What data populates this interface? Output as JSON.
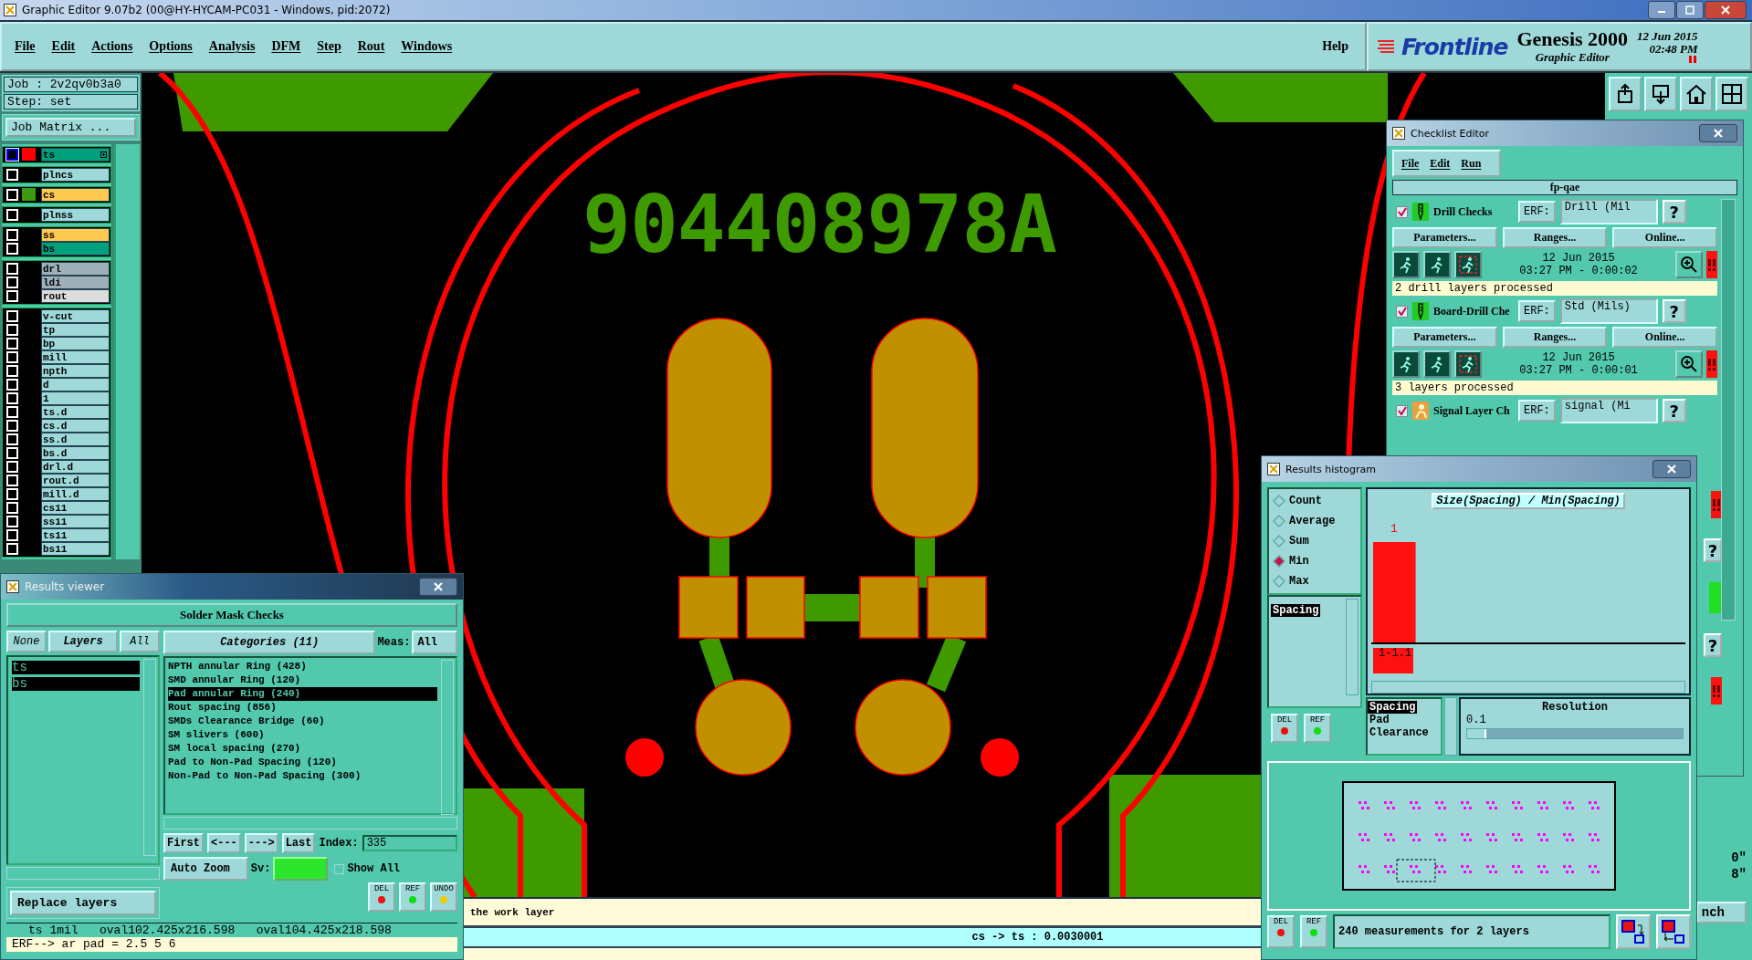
{
  "window": {
    "title": "Graphic Editor 9.07b2 (00@HY-HYCAM-PC031 - Windows, pid:2072)"
  },
  "menu": [
    {
      "label": "File"
    },
    {
      "label": "Edit"
    },
    {
      "label": "Actions"
    },
    {
      "label": "Options"
    },
    {
      "label": "Analysis"
    },
    {
      "label": "DFM"
    },
    {
      "label": "Step"
    },
    {
      "label": "Rout"
    },
    {
      "label": "Windows"
    }
  ],
  "help": "Help",
  "brand": {
    "logo": "Frontline",
    "product": "Genesis 2000",
    "subtitle": "Graphic Editor",
    "date": "12 Jun 2015",
    "time": "02:48 PM"
  },
  "job": {
    "job": "Job : 2v2qv0b3a0",
    "step": "Step: set",
    "matrix_button": "Job Matrix ..."
  },
  "layer_groups": [
    {
      "layers": [
        {
          "name": "ts",
          "color": "#00a07c",
          "swatch": {
            "color": "#ff0000"
          },
          "work_layer": true
        }
      ]
    },
    {
      "layers": [
        {
          "name": "plncs",
          "color": "#9ed8d8",
          "work_layer": false
        }
      ]
    },
    {
      "layers": [
        {
          "name": "cs",
          "color": "#ffc850",
          "swatch": {
            "color": "#3c9a10"
          },
          "work_layer": false
        }
      ]
    },
    {
      "layers": [
        {
          "name": "plnss",
          "color": "#9ed8d8",
          "work_layer": false
        }
      ]
    },
    {
      "layers": [
        {
          "name": "ss",
          "color": "#ffc850",
          "work_layer": false
        },
        {
          "name": "bs",
          "color": "#00a07c",
          "work_layer": false
        }
      ]
    },
    {
      "layers": [
        {
          "name": "drl",
          "color": "#9fb0b8",
          "work_layer": false
        },
        {
          "name": "ldi",
          "color": "#9fb0b8",
          "work_layer": false
        },
        {
          "name": "rout",
          "color": "#dcdcdc",
          "work_layer": false
        }
      ]
    },
    {
      "layers": [
        {
          "name": "v-cut",
          "color": "#9ed8d8",
          "work_layer": false
        },
        {
          "name": "tp",
          "color": "#9ed8d8",
          "work_layer": false
        },
        {
          "name": "bp",
          "color": "#9ed8d8",
          "work_layer": false
        },
        {
          "name": "mill",
          "color": "#9ed8d8",
          "work_layer": false
        },
        {
          "name": "npth",
          "color": "#9ed8d8",
          "work_layer": false
        },
        {
          "name": "d",
          "color": "#9ed8d8",
          "work_layer": false
        },
        {
          "name": "1",
          "color": "#9ed8d8",
          "work_layer": false
        },
        {
          "name": "ts.d",
          "color": "#9ed8d8",
          "work_layer": false
        },
        {
          "name": "cs.d",
          "color": "#9ed8d8",
          "work_layer": false
        },
        {
          "name": "ss.d",
          "color": "#9ed8d8",
          "work_layer": false
        },
        {
          "name": "bs.d",
          "color": "#9ed8d8",
          "work_layer": false
        },
        {
          "name": "drl.d",
          "color": "#9ed8d8",
          "work_layer": false
        },
        {
          "name": "rout.d",
          "color": "#9ed8d8",
          "work_layer": false
        },
        {
          "name": "mill.d",
          "color": "#9ed8d8",
          "work_layer": false
        },
        {
          "name": "cs11",
          "color": "#9ed8d8",
          "work_layer": false
        },
        {
          "name": "ss11",
          "color": "#9ed8d8",
          "work_layer": false
        },
        {
          "name": "ts11",
          "color": "#9ed8d8",
          "work_layer": false
        },
        {
          "name": "bs11",
          "color": "#9ed8d8",
          "work_layer": false
        }
      ]
    }
  ],
  "board_text": "904408978A",
  "prompt": "the work layer",
  "status": "cs -> ts : 0.0030001",
  "right_panel": {
    "lines": [
      "0\"",
      "8\""
    ],
    "unit": "nch"
  },
  "results_viewer": {
    "title": "Results viewer",
    "heading": "Solder Mask Checks",
    "layer_buttons": [
      "None",
      "Layers",
      "All"
    ],
    "layers": [
      {
        "name": "ts",
        "selected": true
      },
      {
        "name": "bs",
        "selected": true
      }
    ],
    "replace": "Replace layers",
    "categories_header": "Categories (11)",
    "meas_label": "Meas:",
    "meas_value": "All",
    "categories": [
      {
        "label": "NPTH annular Ring (428)",
        "selected": false
      },
      {
        "label": "SMD annular Ring (120)",
        "selected": false
      },
      {
        "label": "Pad annular Ring (240)",
        "selected": true
      },
      {
        "label": "Rout spacing (856)",
        "selected": false
      },
      {
        "label": "SMDs Clearance Bridge (60)",
        "selected": false
      },
      {
        "label": "SM slivers (600)",
        "selected": false
      },
      {
        "label": "SM local spacing (270)",
        "selected": false
      },
      {
        "label": "Pad to Non-Pad Spacing (120)",
        "selected": false
      },
      {
        "label": "Non-Pad to Non-Pad Spacing (300)",
        "selected": false
      }
    ],
    "nav": [
      "First",
      "<---",
      "--->",
      "Last"
    ],
    "index_label": "Index:",
    "index_value": "335",
    "zoom": "Auto Zoom",
    "sv_label": "Sv:",
    "show_all": {
      "label": "Show All",
      "checked": false
    },
    "actions": [
      "DEL",
      "REF",
      "UNDO"
    ],
    "info": "ts 1mil   oval102.425x216.598   oval104.425x218.598",
    "erf": "ERF--> ar pad = 2.5 5 6"
  },
  "checklist": {
    "title": "Checklist Editor",
    "menu": [
      "File",
      "Edit",
      "Run"
    ],
    "name": "fp-qae",
    "help": "?",
    "items": [
      {
        "name": "Drill Checks",
        "kind": "drill",
        "checked": true,
        "erf_label": "ERF:",
        "erf": "Drill (Mil",
        "buttons": [
          "Parameters...",
          "Ranges...",
          "Online..."
        ],
        "date": "12 Jun 2015",
        "time": "03:27 PM - 0:00:02",
        "message": "2 drill layers processed"
      },
      {
        "name": "Board-Drill Che",
        "kind": "drill",
        "checked": true,
        "erf_label": "ERF:",
        "erf": "Std (Mils)",
        "buttons": [
          "Parameters...",
          "Ranges...",
          "Online..."
        ],
        "date": "12 Jun 2015",
        "time": "03:27 PM - 0:00:01",
        "message": "3 layers processed"
      },
      {
        "name": "Signal Layer Ch",
        "kind": "signal",
        "checked": true,
        "erf_label": "ERF:",
        "erf": "signal (Mi"
      }
    ],
    "edge": [
      {
        "kind": "flag"
      },
      {
        "kind": "help",
        "label": "?"
      },
      {
        "kind": "ok"
      },
      {
        "kind": "help",
        "label": "?"
      },
      {
        "kind": "flag"
      }
    ]
  },
  "histogram": {
    "title": "Results histogram",
    "stats": [
      {
        "label": "Count",
        "selected": false
      },
      {
        "label": "Average",
        "selected": false
      },
      {
        "label": "Sum",
        "selected": false
      },
      {
        "label": "Min",
        "selected": true
      },
      {
        "label": "Max",
        "selected": false
      }
    ],
    "measures": [
      {
        "label": "Spacing",
        "selected": true
      }
    ],
    "actions": [
      "DEL",
      "REF"
    ],
    "chart": {
      "title": "Size(Spacing) / Min(Spacing)",
      "bins": [
        {
          "count": "1",
          "range": "1-1.1"
        }
      ]
    },
    "fields": [
      {
        "label": "Spacing",
        "selected": true
      },
      {
        "label": "Pad",
        "selected": false
      },
      {
        "label": "Clearance",
        "selected": false
      }
    ],
    "resolution_label": "Resolution",
    "resolution": "0.1",
    "resolution_slider": {
      "level": 0.08
    },
    "footer_actions": [
      "DEL",
      "REF"
    ],
    "summary": "240 measurements for 2 layers"
  }
}
